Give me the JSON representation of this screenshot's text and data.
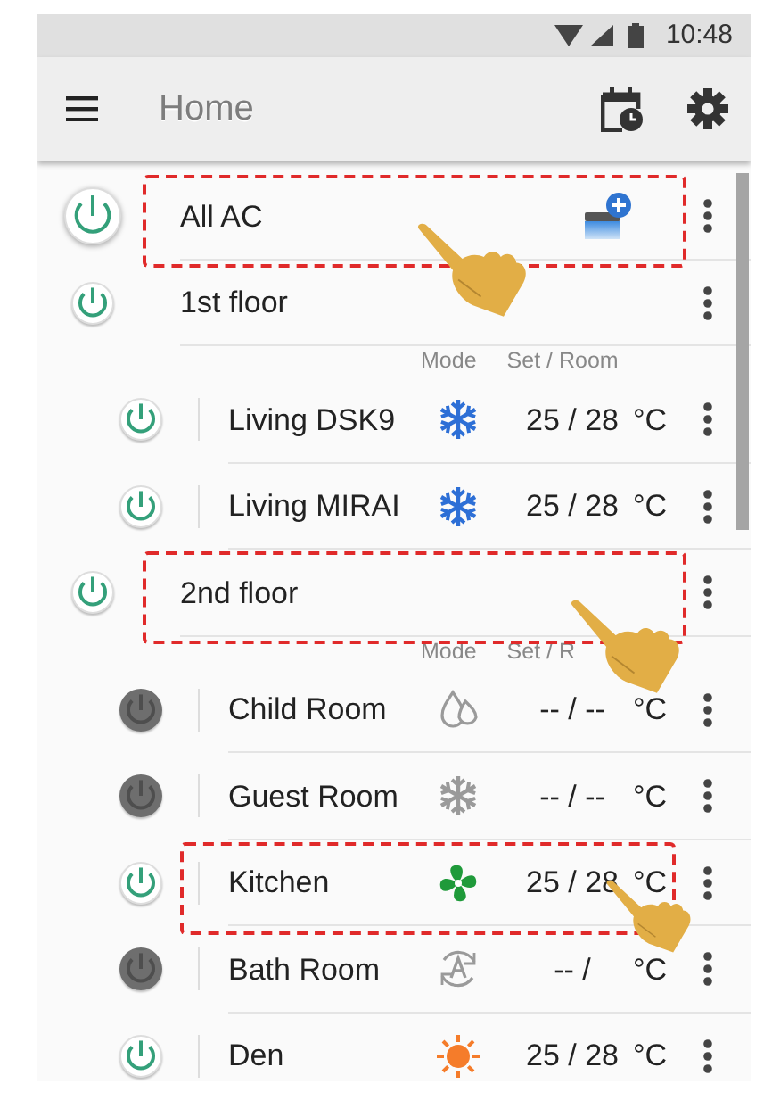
{
  "status_bar": {
    "time": "10:48"
  },
  "toolbar": {
    "title": "Home"
  },
  "rows": [
    {
      "kind": "all",
      "name": "All AC",
      "power_on": true,
      "highlighted": true,
      "pointer": true
    },
    {
      "kind": "group",
      "name": "1st floor",
      "power_on": true,
      "highlighted": false,
      "pointer": false
    },
    {
      "kind": "header",
      "mode_label": "Mode",
      "set_label": "Set / Room"
    },
    {
      "kind": "unit",
      "name": "Living DSK9",
      "power_on": true,
      "mode": {
        "kind": "cool"
      },
      "setting": "25 / 28",
      "unit": "°C",
      "highlighted": false,
      "pointer": false
    },
    {
      "kind": "unit",
      "name": "Living MIRAI",
      "power_on": true,
      "mode": {
        "kind": "cool"
      },
      "setting": "25 / 28",
      "unit": "°C",
      "highlighted": false,
      "pointer": false
    },
    {
      "kind": "group",
      "name": "2nd floor",
      "power_on": true,
      "highlighted": true,
      "pointer": true
    },
    {
      "kind": "header",
      "mode_label": "Mode",
      "set_label": "Set / R"
    },
    {
      "kind": "unit",
      "name": "Child Room",
      "power_on": false,
      "mode": {
        "kind": "dry"
      },
      "setting": "-- / --",
      "unit": "°C",
      "highlighted": false,
      "pointer": false
    },
    {
      "kind": "unit",
      "name": "Guest Room",
      "power_on": false,
      "mode": {
        "kind": "cool"
      },
      "setting": "-- / --",
      "unit": "°C",
      "highlighted": false,
      "pointer": false
    },
    {
      "kind": "unit",
      "name": "Kitchen",
      "power_on": true,
      "mode": {
        "kind": "fan"
      },
      "setting": "25 / 28",
      "unit": "°C",
      "highlighted": true,
      "pointer": true
    },
    {
      "kind": "unit",
      "name": "Bath Room",
      "power_on": false,
      "mode": {
        "kind": "auto"
      },
      "setting": "-- /",
      "unit": "°C",
      "highlighted": false,
      "pointer": false
    },
    {
      "kind": "unit",
      "name": "Den",
      "power_on": true,
      "mode": {
        "kind": "heat"
      },
      "setting": "25 / 28",
      "unit": "°C",
      "highlighted": false,
      "pointer": false
    }
  ]
}
